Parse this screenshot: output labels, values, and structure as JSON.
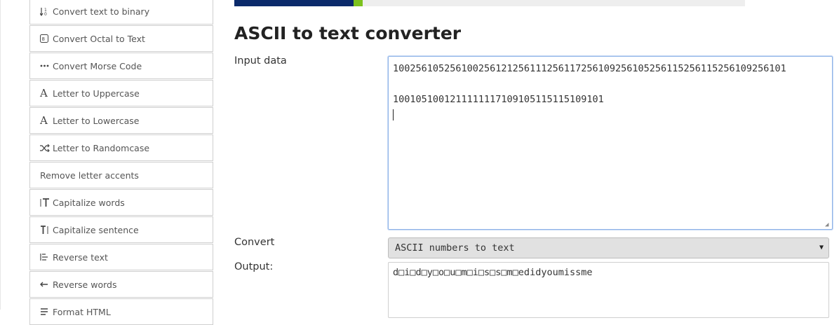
{
  "sidebar": {
    "items": [
      {
        "label": "Convert text to binary",
        "icon": "sort-numeric-icon"
      },
      {
        "label": "Convert Octal to Text",
        "icon": "octal-box-icon"
      },
      {
        "label": "Convert Morse Code",
        "icon": "dots-icon"
      },
      {
        "label": "Letter to Uppercase",
        "icon": "letter-a-icon"
      },
      {
        "label": "Letter to Lowercase",
        "icon": "letter-a-icon"
      },
      {
        "label": "Letter to Randomcase",
        "icon": "shuffle-icon"
      },
      {
        "label": "Remove letter accents",
        "icon": ""
      },
      {
        "label": "Capitalize words",
        "icon": "capital-t-icon"
      },
      {
        "label": "Capitalize sentence",
        "icon": "capital-t-cursor-icon"
      },
      {
        "label": "Reverse text",
        "icon": "reverse-list-icon"
      },
      {
        "label": "Reverse words",
        "icon": "arrow-left-icon"
      },
      {
        "label": "Format HTML",
        "icon": "code-icon"
      }
    ]
  },
  "progress": {
    "value": 0.233,
    "fill_color": "#0b2a6b",
    "accent_color": "#7dc21e"
  },
  "main": {
    "title": "ASCII to text converter",
    "input_label": "Input data",
    "input_value": "100256105256100256121256111256117256109256105256115256115256109256101\n\n1001051001211111117109105115115109101\n",
    "convert_label": "Convert",
    "convert_selected": "ASCII numbers to text",
    "output_label": "Output:",
    "output_value": "d□i□d□y□o□u□m□i□s□s□m□edidyoumissme"
  }
}
